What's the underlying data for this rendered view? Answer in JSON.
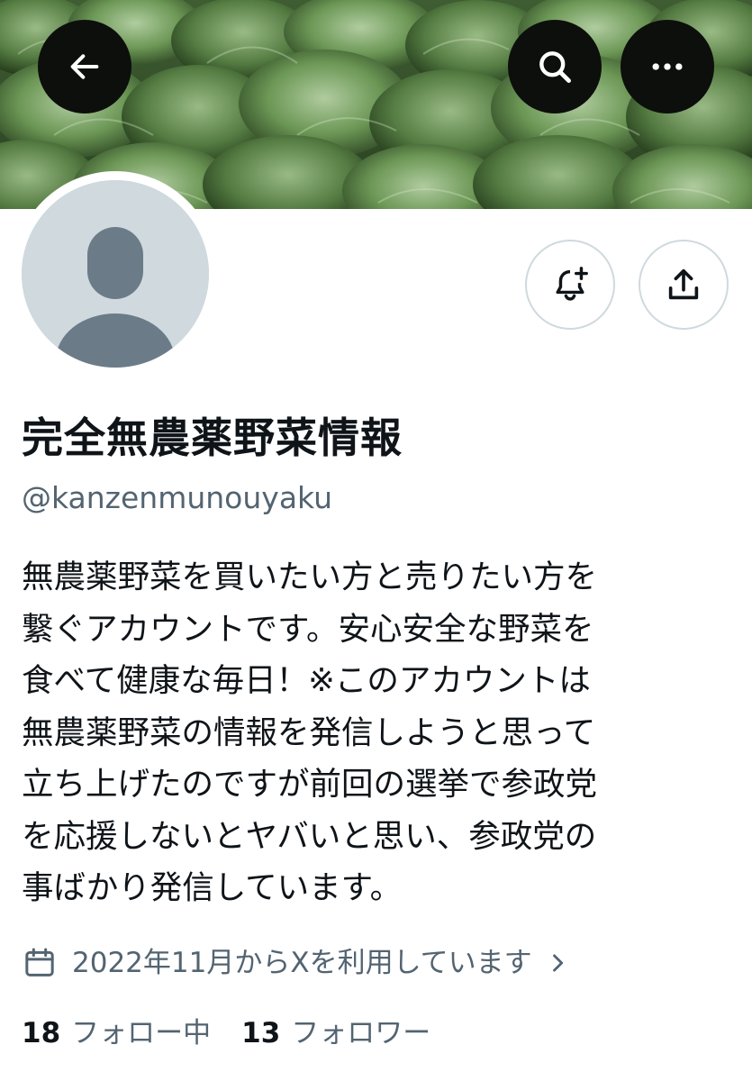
{
  "banner": {
    "image": "green-lettuce-field",
    "colors": [
      "#2f4a25",
      "#5f8a4c",
      "#a9c79a"
    ]
  },
  "nav": {
    "back_icon": "arrow-left-icon",
    "search_icon": "search-icon",
    "more_icon": "more-horizontal-icon"
  },
  "profile": {
    "display_name": "完全無農薬野菜情報",
    "handle": "@kanzenmunouyaku",
    "bio": "無農薬野菜を買いたい方と売りたい方を\n繋ぐアカウントです。安心安全な野菜を\n食べて健康な毎日！※このアカウントは\n無農薬野菜の情報を発信しようと思って\n立ち上げたのですが前回の選挙で参政党\nを応援しないとヤバいと思い、参政党の\n事ばかり発信しています。",
    "joined": "2022年11月からXを利用しています"
  },
  "actions": {
    "notify_icon": "bell-plus-icon",
    "share_icon": "share-upload-icon"
  },
  "stats": {
    "following_count": "18",
    "following_label": "フォロー中",
    "followers_count": "13",
    "followers_label": "フォロワー"
  },
  "colors": {
    "text_primary": "#0f1419",
    "text_secondary": "#536471",
    "border": "#cfd9de",
    "nav_button_bg": "#0d0f0c"
  }
}
